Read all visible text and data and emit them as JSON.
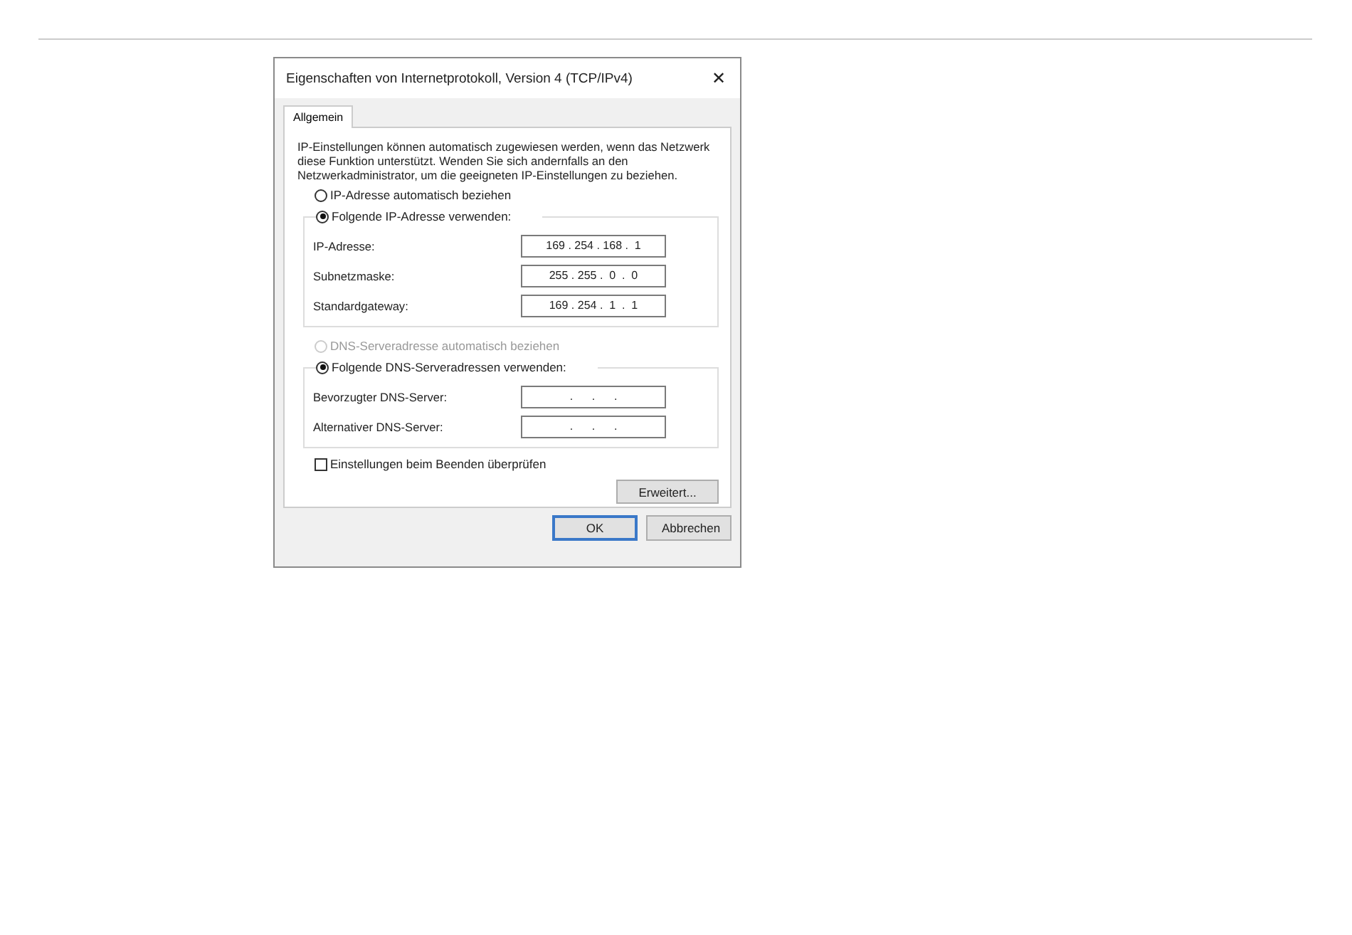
{
  "window": {
    "title": "Eigenschaften von Internetprotokoll, Version 4 (TCP/IPv4)",
    "close": "✕"
  },
  "tabs": [
    {
      "label": "Allgemein",
      "selected": true
    }
  ],
  "intro": "IP-Einstellungen können automatisch zugewiesen werden, wenn das Netzwerk diese Funktion unterstützt. Wenden Sie sich andernfalls an den Netzwerkadministrator, um die geeigneten IP-Einstellungen zu beziehen.",
  "ip_auto": {
    "label": "IP-Adresse automatisch beziehen",
    "selected": false,
    "disabled": false
  },
  "ip_manual": {
    "label": "Folgende IP-Adresse verwenden:",
    "selected": true,
    "disabled": false,
    "fields": [
      {
        "label": "IP-Adresse:",
        "value": "169 . 254 . 168 .  1"
      },
      {
        "label": "Subnetzmaske:",
        "value": "255 . 255 .  0  .  0"
      },
      {
        "label": "Standardgateway:",
        "value": "169 . 254 .  1  .  1"
      }
    ]
  },
  "dns_auto": {
    "label": "DNS-Serveradresse automatisch beziehen",
    "selected": false,
    "disabled": true
  },
  "dns_manual": {
    "label": "Folgende DNS-Serveradressen verwenden:",
    "selected": true,
    "disabled": false,
    "fields": [
      {
        "label": "Bevorzugter DNS-Server:",
        "value": ".      .      ."
      },
      {
        "label": "Alternativer DNS-Server:",
        "value": ".      .      ."
      }
    ]
  },
  "validate": {
    "label": "Einstellungen beim Beenden überprüfen",
    "checked": false
  },
  "advanced_button": "Erweitert...",
  "buttons": [
    {
      "label": "OK",
      "default": true
    },
    {
      "label": "Abbrechen",
      "default": false
    }
  ]
}
